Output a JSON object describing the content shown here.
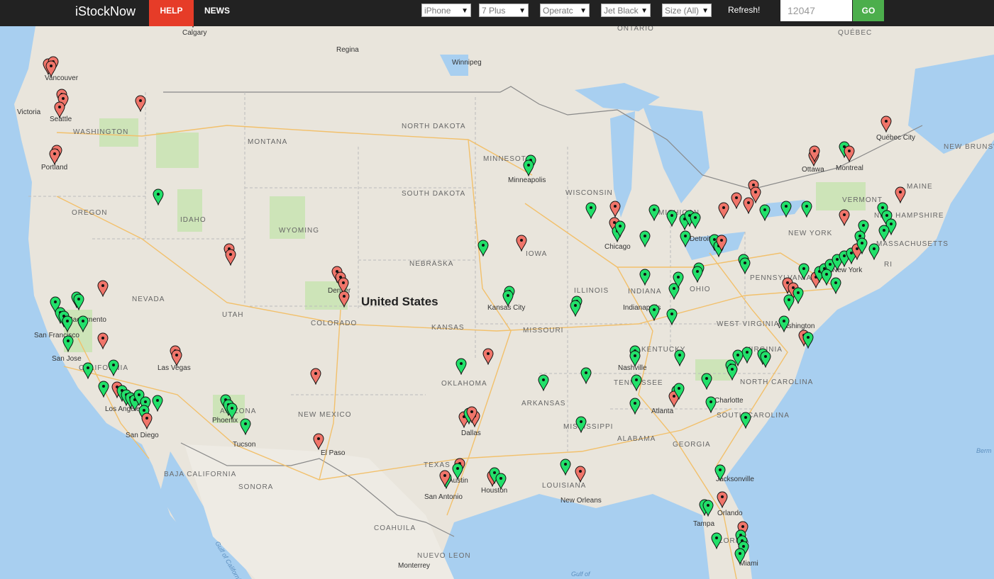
{
  "navbar": {
    "brand": "iStockNow",
    "help": "HELP",
    "news": "NEWS",
    "filters": {
      "device": "iPhone",
      "model": "7 Plus",
      "operator": "Operatc",
      "color": "Jet Black",
      "size": "Size (All)"
    },
    "refresh": "Refresh!",
    "zip_value": "12047",
    "go": "GO"
  },
  "map": {
    "country_label": "United States",
    "regions": [
      "ONTARIO",
      "QUÉBEC",
      "NEW BRUNSWICK",
      "BAJA CALIFORNIA",
      "SONORA",
      "COAHUILA",
      "NUEVO LEON"
    ],
    "states": [
      "WASHINGTON",
      "OREGON",
      "IDAHO",
      "MONTANA",
      "WYOMING",
      "NORTH DAKOTA",
      "SOUTH DAKOTA",
      "NEBRASKA",
      "KANSAS",
      "COLORADO",
      "UTAH",
      "NEVADA",
      "CALIFORNIA",
      "ARIZONA",
      "NEW MEXICO",
      "TEXAS",
      "OKLAHOMA",
      "MINNESOTA",
      "IOWA",
      "MISSOURI",
      "ARKANSAS",
      "LOUISIANA",
      "MISSISSIPPI",
      "ALABAMA",
      "GEORGIA",
      "TENNESSEE",
      "KENTUCKY",
      "ILLINOIS",
      "INDIANA",
      "OHIO",
      "MICHIGAN",
      "WISCONSIN",
      "PENNSYLVANIA",
      "NEW YORK",
      "VERMONT",
      "MAINE",
      "NEW HAMPSHIRE",
      "MASSACHUSETTS",
      "RI",
      "WEST VIRGINIA",
      "VIRGINIA",
      "NORTH CAROLINA",
      "SOUTH CAROLINA",
      "FLORIDA"
    ],
    "cities": [
      "Calgary",
      "Regina",
      "Winnipeg",
      "Vancouver",
      "Victoria",
      "Seattle",
      "Portland",
      "Sacramento",
      "San Francisco",
      "San Jose",
      "Los Angeles",
      "San Diego",
      "Las Vegas",
      "Phoenix",
      "Tucson",
      "El Paso",
      "Denver",
      "Kansas City",
      "Minneapolis",
      "Chicago",
      "Detroit",
      "Indianapolis",
      "Nashville",
      "Atlanta",
      "Charlotte",
      "Washington",
      "New York",
      "Ottawa",
      "Montreal",
      "Québec City",
      "Dallas",
      "Austin",
      "San Antonio",
      "Houston",
      "New Orleans",
      "Jacksonville",
      "Orlando",
      "Tampa",
      "Miami",
      "Monterrey"
    ],
    "water": [
      "Gulf of California",
      "Gulf of",
      "Berm"
    ],
    "colors": {
      "in_stock": "#22e06a",
      "out_of_stock": "#f0756a"
    }
  }
}
